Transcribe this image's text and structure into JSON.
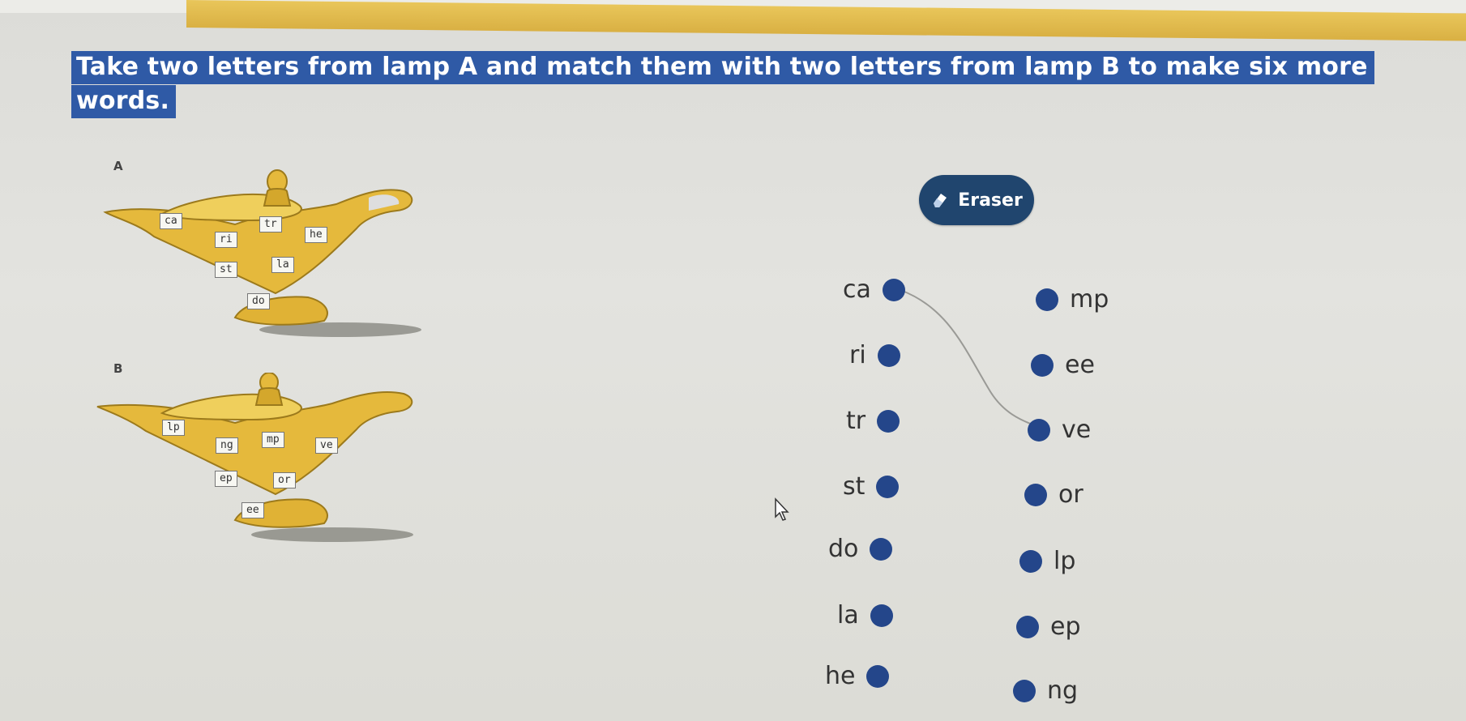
{
  "instruction": "Take two letters from lamp A and match them with two letters from lamp B to make six more words.",
  "lamp_a": {
    "label": "A",
    "tiles": [
      "ca",
      "tr",
      "ri",
      "he",
      "st",
      "la",
      "do"
    ]
  },
  "lamp_b": {
    "label": "B",
    "tiles": [
      "lp",
      "ng",
      "mp",
      "ve",
      "ep",
      "or",
      "ee"
    ]
  },
  "eraser": {
    "label": "Eraser",
    "icon": "eraser-icon"
  },
  "left_column": [
    {
      "text": "ca"
    },
    {
      "text": "ri"
    },
    {
      "text": "tr"
    },
    {
      "text": "st"
    },
    {
      "text": "do"
    },
    {
      "text": "la"
    },
    {
      "text": "he"
    }
  ],
  "right_column": [
    {
      "text": "mp"
    },
    {
      "text": "ee"
    },
    {
      "text": "ve"
    },
    {
      "text": "or"
    },
    {
      "text": "lp"
    },
    {
      "text": "ep"
    },
    {
      "text": "ng"
    }
  ],
  "matches": [
    {
      "from": "ca",
      "to": "ve"
    }
  ],
  "colors": {
    "instruction_bg": "#2f5aa6",
    "dot": "#24468a",
    "eraser_bg": "#20456e",
    "lamp_gold": "#e2b536",
    "top_strip": "#e9c65a"
  }
}
